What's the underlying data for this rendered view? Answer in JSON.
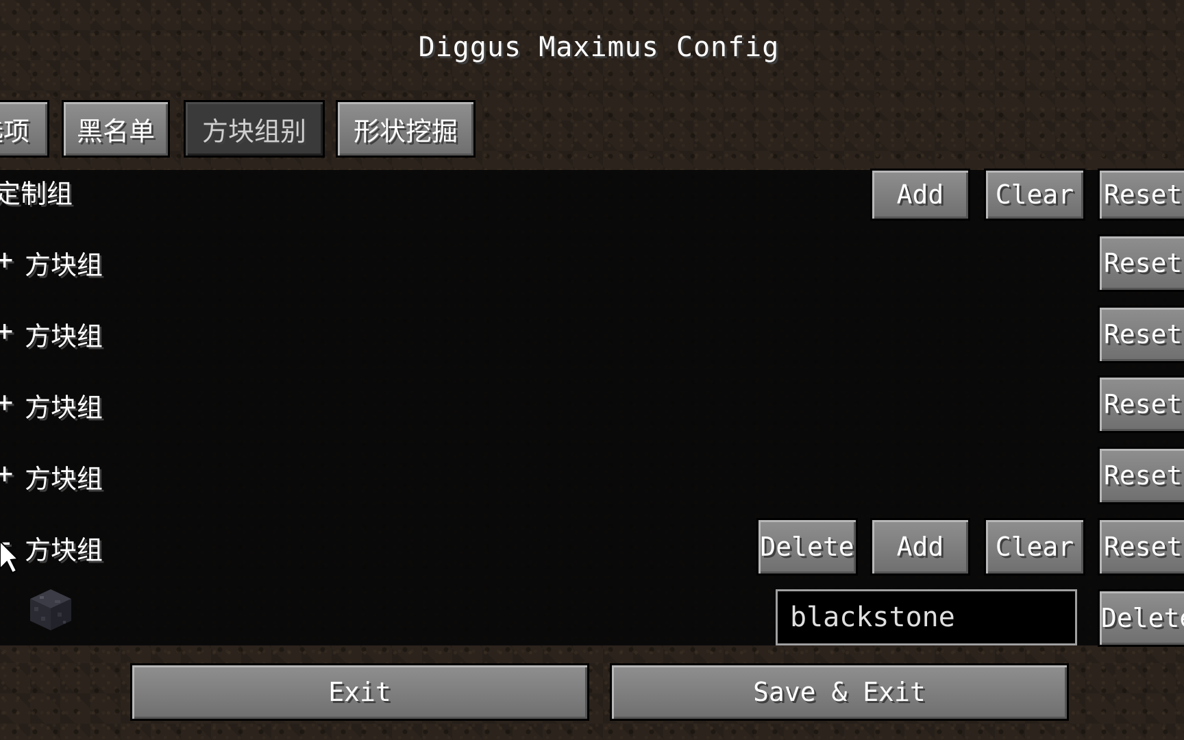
{
  "title": "Diggus Maximus Config",
  "tabs": [
    {
      "label": "选项",
      "visible": "选项"
    },
    {
      "label": "黑名单"
    },
    {
      "label": "方块组别",
      "active": true
    },
    {
      "label": "形状挖掘"
    }
  ],
  "tab_visible_first": "选项",
  "header_row": {
    "label": "定制组",
    "add_label": "Add",
    "clear_label": "Clear",
    "reset_label": "Reset"
  },
  "groups": [
    {
      "sign": "+",
      "label": "方块组",
      "reset_label": "Reset"
    },
    {
      "sign": "+",
      "label": "方块组",
      "reset_label": "Reset"
    },
    {
      "sign": "+",
      "label": "方块组",
      "reset_label": "Reset"
    },
    {
      "sign": "+",
      "label": "方块组",
      "reset_label": "Reset"
    },
    {
      "sign": "-",
      "label": "方块组",
      "delete_label": "Delete",
      "add_label": "Add",
      "clear_label": "Clear",
      "reset_label": "Reset"
    }
  ],
  "entry": {
    "value": "blackstone",
    "delete_label": "Delete",
    "icon": "blackstone-block-icon"
  },
  "footer": {
    "exit_label": "Exit",
    "save_exit_label": "Save & Exit"
  },
  "colors": {
    "button": "#7f7f7f",
    "active_tab": "#3a3a3a",
    "panel": "#080808",
    "text": "#ffffff"
  }
}
